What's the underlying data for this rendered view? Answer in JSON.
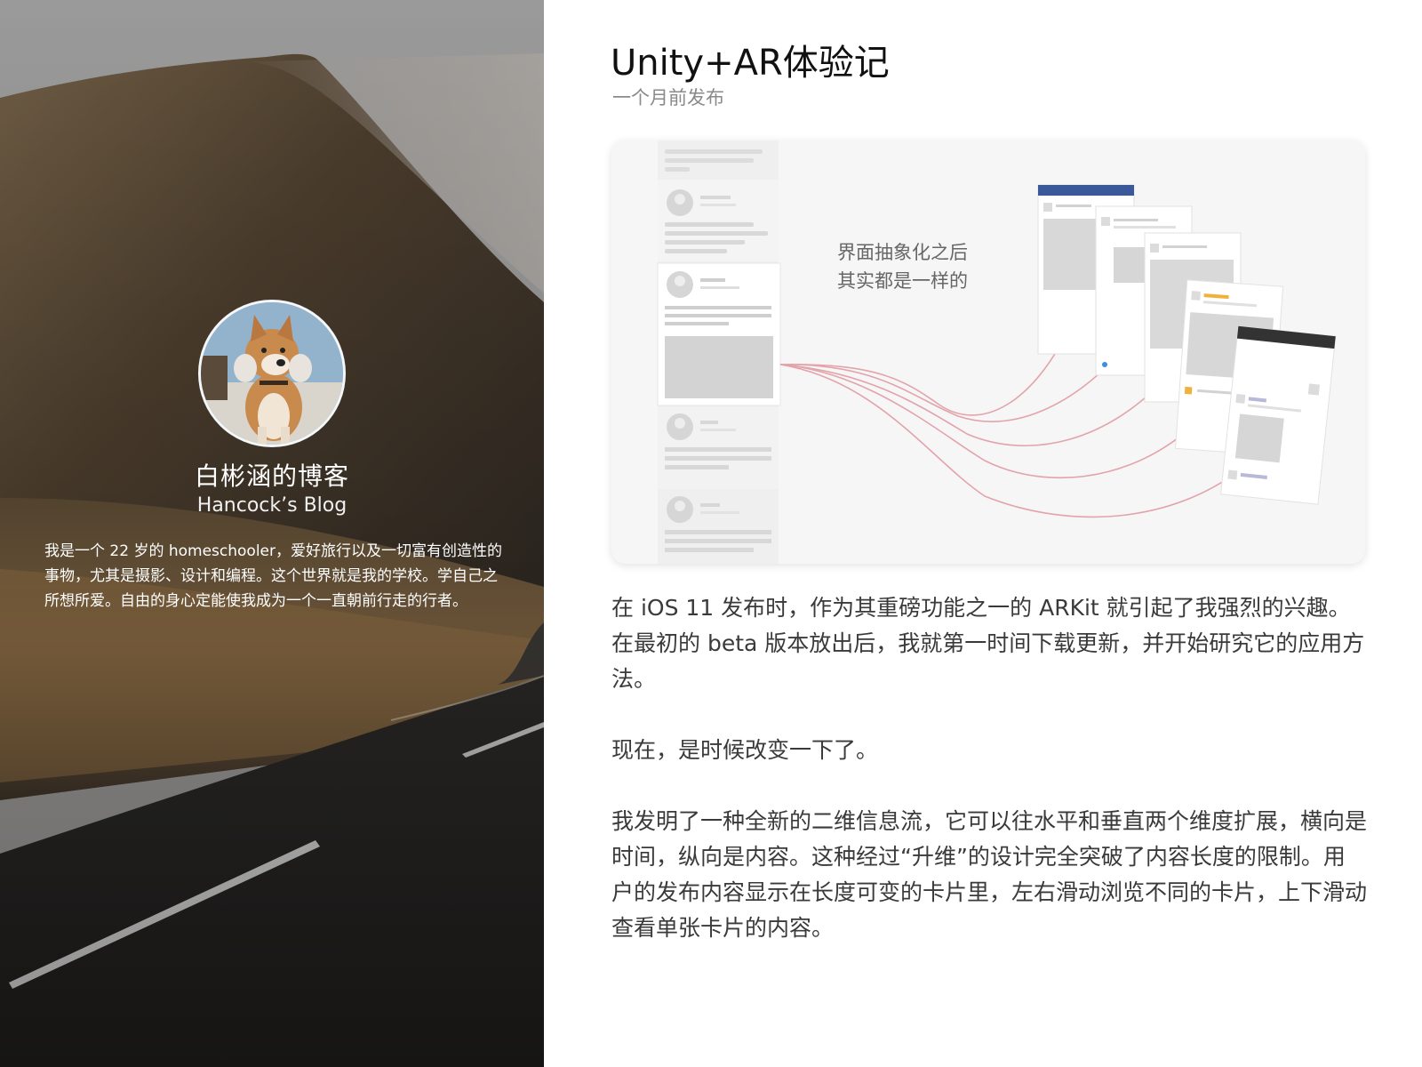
{
  "sidebar": {
    "title": "白彬涵的博客",
    "subtitle": "Hancock’s Blog",
    "bio": "我是一个 22 岁的 homeschooler，爱好旅行以及一切富有创造性的事物，尤其是摄影、设计和编程。这个世界就是我的学校。学自己之所想所爱。自由的身心定能使我成为一个一直朝前行走的行者。"
  },
  "post": {
    "title": "Unity+AR体验记",
    "meta": "一个月前发布",
    "hero_caption_line1": "界面抽象化之后",
    "hero_caption_line2": "其实都是一样的",
    "paragraphs": [
      "在 iOS 11 发布时，作为其重磅功能之一的 ARKit 就引起了我强烈的兴趣。在最初的 beta 版本放出后，我就第一时间下载更新，并开始研究它的应用方法。",
      "现在，是时候改变一下了。",
      "我发明了一种全新的二维信息流，它可以往水平和垂直两个维度扩展，横向是时间，纵向是内容。这种经过“升维”的设计完全突破了内容长度的限制。用户的发布内容显示在长度可变的卡片里，左右滑动浏览不同的卡片，上下滑动查看单张卡片的内容。"
    ]
  }
}
